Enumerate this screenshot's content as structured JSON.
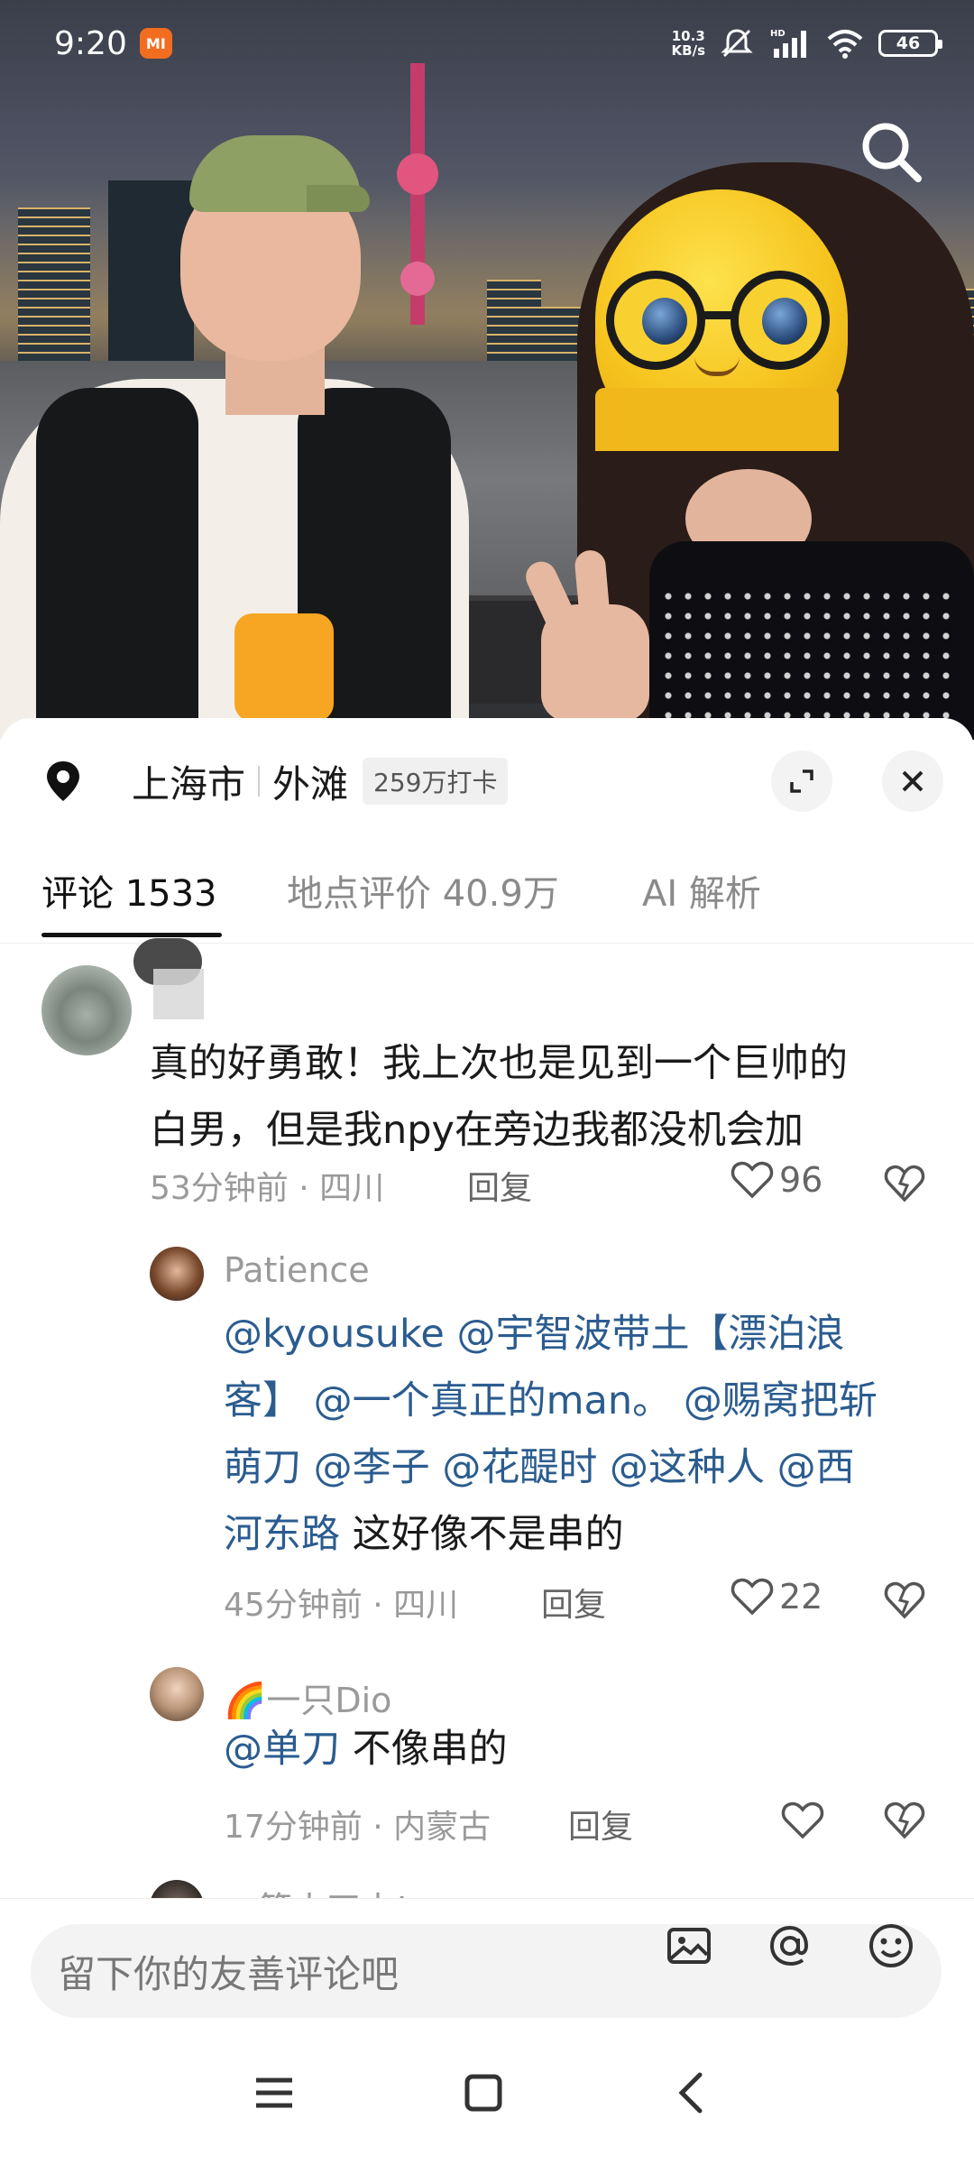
{
  "status_bar": {
    "time": "9:20",
    "mi_badge": "MI",
    "net_speed_value": "10.3",
    "net_speed_unit": "KB/s",
    "battery": "46",
    "icons": [
      "mute-icon",
      "hd-signal-icon",
      "wifi-icon",
      "battery-icon"
    ]
  },
  "location": {
    "city": "上海市",
    "place": "外滩",
    "checkins": "259万打卡"
  },
  "tabs": [
    {
      "label": "评论 1533",
      "active": true
    },
    {
      "label": "地点评价 40.9万",
      "active": false
    },
    {
      "label": "AI 解析",
      "active": false
    }
  ],
  "comments": [
    {
      "text": "真的好勇敢！我上次也是见到一个巨帅的白男，但是我npy在旁边我都没机会加",
      "line1": "真的好勇敢！我上次也是见到一个巨帅的",
      "line2": "白男，但是我npy在旁边我都没机会加",
      "meta": "53分钟前 · 四川",
      "reply": "回复",
      "likes": "96"
    },
    {
      "name": "Patience",
      "lines": [
        [
          {
            "t": "@kyousuke @宇智波带土【漂泊浪",
            "m": true
          }
        ],
        [
          {
            "t": "客】 @一个真正的man。 @赐窝把斩",
            "m": true
          }
        ],
        [
          {
            "t": "萌刀 @李子 @花醍时 @这种人 @西",
            "m": true
          }
        ],
        [
          {
            "t": "河东路",
            "m": true
          },
          {
            "t": " 这好像不是串的",
            "m": false
          }
        ]
      ],
      "meta": "45分钟前 · 四川",
      "reply": "回复",
      "likes": "22"
    },
    {
      "name": "🌈一只Dio",
      "mention": "@单刀",
      "text": " 不像串的",
      "meta": "17分钟前 · 内蒙古",
      "reply": "回复",
      "likes": ""
    },
    {
      "name": "一箭大四大!"
    }
  ],
  "input": {
    "placeholder": "留下你的友善评论吧"
  },
  "colors": {
    "mention": "#2b5c8f",
    "mi_orange": "#f36d21"
  }
}
